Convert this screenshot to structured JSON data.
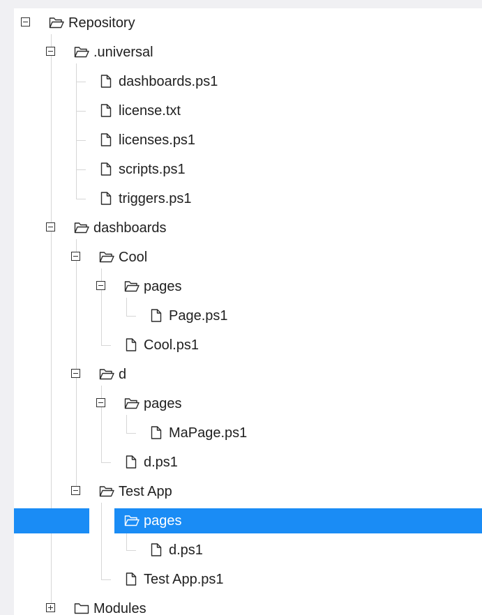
{
  "tree": [
    {
      "label": "Repository",
      "type": "folder",
      "depth": 0,
      "state": "expanded"
    },
    {
      "label": ".universal",
      "type": "folder",
      "depth": 1,
      "state": "expanded"
    },
    {
      "label": "dashboards.ps1",
      "type": "file",
      "depth": 2
    },
    {
      "label": "license.txt",
      "type": "file",
      "depth": 2
    },
    {
      "label": "licenses.ps1",
      "type": "file",
      "depth": 2
    },
    {
      "label": "scripts.ps1",
      "type": "file",
      "depth": 2
    },
    {
      "label": "triggers.ps1",
      "type": "file",
      "depth": 2
    },
    {
      "label": "dashboards",
      "type": "folder",
      "depth": 1,
      "state": "expanded"
    },
    {
      "label": "Cool",
      "type": "folder",
      "depth": 2,
      "state": "expanded"
    },
    {
      "label": "pages",
      "type": "folder",
      "depth": 3,
      "state": "expanded"
    },
    {
      "label": "Page.ps1",
      "type": "file",
      "depth": 4
    },
    {
      "label": "Cool.ps1",
      "type": "file",
      "depth": 3
    },
    {
      "label": "d",
      "type": "folder",
      "depth": 2,
      "state": "expanded"
    },
    {
      "label": "pages",
      "type": "folder",
      "depth": 3,
      "state": "expanded"
    },
    {
      "label": "MaPage.ps1",
      "type": "file",
      "depth": 4
    },
    {
      "label": "d.ps1",
      "type": "file",
      "depth": 3
    },
    {
      "label": "Test App",
      "type": "folder",
      "depth": 2,
      "state": "expanded"
    },
    {
      "label": "pages",
      "type": "folder",
      "depth": 3,
      "state": "expanded",
      "selected": true,
      "toggle_hidden": true
    },
    {
      "label": "d.ps1",
      "type": "file",
      "depth": 4
    },
    {
      "label": "Test App.ps1",
      "type": "file",
      "depth": 3
    },
    {
      "label": "Modules",
      "type": "folder",
      "depth": 1,
      "state": "collapsed"
    }
  ],
  "icons": {
    "folder_open": "folder-open-icon",
    "folder_closed": "folder-icon",
    "file": "file-icon"
  },
  "colors": {
    "selection": "#1a8cf5",
    "text": "#1f1f1f",
    "guide_line": "#d6d6d6",
    "background": "#ffffff"
  }
}
